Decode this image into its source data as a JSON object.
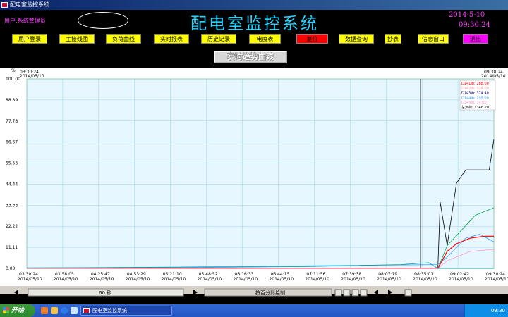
{
  "window": {
    "title": "配电室监控系统"
  },
  "header": {
    "user_label": "用户:系统管理员",
    "main_title": "配电室监控系统",
    "date": "2014-5-10",
    "time": "09:30:24"
  },
  "nav": [
    {
      "label": "用户登录",
      "bg": "#ffff00"
    },
    {
      "label": "主接线图",
      "bg": "#ffff00"
    },
    {
      "label": "负荷曲线",
      "bg": "#ffff00"
    },
    {
      "label": "实时报表",
      "bg": "#ffff00"
    },
    {
      "label": "历史记录",
      "bg": "#ffff00"
    },
    {
      "label": "电度表",
      "bg": "#ffff00"
    },
    {
      "label": "复位",
      "bg": "#ff0000"
    },
    {
      "label": "数据查询",
      "bg": "#ffff00"
    },
    {
      "label": "抄表",
      "bg": "#ffff00"
    },
    {
      "label": "信息窗口",
      "bg": "#ffff00"
    },
    {
      "label": "退出",
      "bg": "#ff00ff"
    }
  ],
  "chart_title_button": "实时趋势曲线",
  "chart_data": {
    "type": "line",
    "ylabel": "%",
    "ylim": [
      0,
      100
    ],
    "y_ticks": [
      "0.00",
      "11.11",
      "22.22",
      "33.33",
      "44.44",
      "55.56",
      "66.67",
      "77.78",
      "88.89",
      "100.00"
    ],
    "x_ticks": [
      {
        "time": "03:30:24",
        "date": "2014/05/10"
      },
      {
        "time": "03:58:05",
        "date": "2014/05/10"
      },
      {
        "time": "04:25:47",
        "date": "2014/05/10"
      },
      {
        "time": "04:53:29",
        "date": "2014/05/10"
      },
      {
        "time": "05:21:10",
        "date": "2014/05/10"
      },
      {
        "time": "05:48:52",
        "date": "2014/05/10"
      },
      {
        "time": "06:16:33",
        "date": "2014/05/10"
      },
      {
        "time": "06:44:15",
        "date": "2014/05/10"
      },
      {
        "time": "07:11:56",
        "date": "2014/05/10"
      },
      {
        "time": "07:39:38",
        "date": "2014/05/10"
      },
      {
        "time": "08:07:19",
        "date": "2014/05/10"
      },
      {
        "time": "08:35:01",
        "date": "2014/05/10"
      },
      {
        "time": "09:02:42",
        "date": "2014/05/10"
      },
      {
        "time": "09:30:24",
        "date": "2014/05/10"
      }
    ],
    "top_left_time": "03:30:24",
    "top_left_date": "2014/05/10",
    "top_right_time": "09:30:24",
    "top_right_date": "2014/05/10",
    "grid": true,
    "legend_position": "top-right",
    "legend": [
      {
        "label": "D141Ib: 288.00",
        "color": "#ff0000"
      },
      {
        "label": "D142Ib: 324.00",
        "color": "#ff9999"
      },
      {
        "label": "D143Ib: 374.40",
        "color": "#000080"
      },
      {
        "label": "D144Ib: 295.00",
        "color": "#3399ff"
      },
      {
        "label": "D145Ib: 34.00",
        "color": "#ff99cc"
      },
      {
        "label": "总负荷: 1346.20",
        "color": "#000000"
      }
    ],
    "series": [
      {
        "color": "#000000",
        "x": [
          0,
          0.88,
          0.885,
          0.9,
          0.92,
          0.94,
          0.97,
          0.99,
          1.0
        ],
        "y": [
          0,
          0,
          35,
          12,
          45,
          52,
          52,
          52,
          68
        ]
      },
      {
        "color": "#00aa44",
        "x": [
          0,
          0.88,
          0.9,
          0.93,
          0.96,
          0.98,
          1.0
        ],
        "y": [
          0,
          0,
          12,
          20,
          28,
          30,
          32
        ]
      },
      {
        "color": "#3399ff",
        "x": [
          0,
          0.88,
          0.9,
          0.94,
          0.97,
          1.0
        ],
        "y": [
          0,
          2,
          6,
          16,
          18,
          14
        ]
      },
      {
        "color": "#ff0000",
        "x": [
          0,
          0.88,
          0.9,
          0.92,
          0.95,
          0.98,
          1.0
        ],
        "y": [
          0,
          0,
          9,
          13,
          16,
          17,
          17
        ]
      },
      {
        "color": "#ff99cc",
        "x": [
          0,
          0.88,
          0.9,
          0.95,
          1.0
        ],
        "y": [
          0,
          0,
          4,
          9,
          10
        ]
      },
      {
        "color": "#009999",
        "x": [
          0,
          0.2,
          0.4,
          0.6,
          0.8,
          0.86,
          0.88,
          1.0
        ],
        "y": [
          0.3,
          0.5,
          0.6,
          1.0,
          2.0,
          3.0,
          0,
          0
        ]
      }
    ]
  },
  "scroll": {
    "interval": "60 秒",
    "mode": "按百分比绘制"
  },
  "taskbar": {
    "start": "开始",
    "task": "配电室监控系统",
    "clock": "09:30"
  }
}
